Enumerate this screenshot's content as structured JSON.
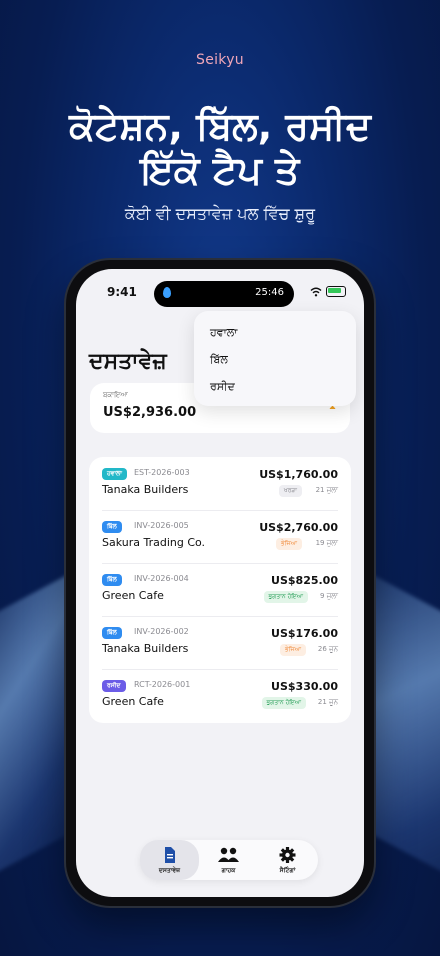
{
  "brand": "Seikyu",
  "headline": {
    "line1": "ਕੋਟੇਸ਼ਨ, ਬਿੱਲ, ਰਸੀਦ",
    "line2": "ਇੱਕੋ ਟੈਪ ਤੇ"
  },
  "subline": "ਕੋਈ ਵੀ ਦਸਤਾਵੇਜ਼ ਪਲ ਵਿੱਚ ਸ਼ੁਰੂ",
  "status_bar": {
    "time": "9:41",
    "island_time": "25:46"
  },
  "page_title": "ਦਸਤਾਵੇਜ਼",
  "menu": {
    "items": [
      "ਹਵਾਲਾ",
      "ਬਿੱਲ",
      "ਰਸੀਦ"
    ]
  },
  "summary": {
    "label": "ਬਕਾਇਆ",
    "value": "US$2,936.00"
  },
  "documents": [
    {
      "type": "ਹਵਾਲਾ",
      "type_color": "#22b8c8",
      "id": "EST-2026-003",
      "client": "Tanaka Builders",
      "amount": "US$1,760.00",
      "status": "ਖਰੜਾ",
      "status_color": "#8a8a90",
      "status_bg": "#eeeef2",
      "date": "21 ਜੁਲਾ"
    },
    {
      "type": "ਬਿੱਲ",
      "type_color": "#2f8cf0",
      "id": "INV-2026-005",
      "client": "Sakura Trading Co.",
      "amount": "US$2,760.00",
      "status": "ਭੇਜਿਆ",
      "status_color": "#f08a3a",
      "status_bg": "#fdeee2",
      "date": "19 ਜੁਲਾ"
    },
    {
      "type": "ਬਿੱਲ",
      "type_color": "#2f8cf0",
      "id": "INV-2026-004",
      "client": "Green Cafe",
      "amount": "US$825.00",
      "status": "ਭੁਗਤਾਨ ਹੋਇਆ",
      "status_color": "#2aa05a",
      "status_bg": "#e2f5e8",
      "date": "9 ਜੁਲਾ"
    },
    {
      "type": "ਬਿੱਲ",
      "type_color": "#2f8cf0",
      "id": "INV-2026-002",
      "client": "Tanaka Builders",
      "amount": "US$176.00",
      "status": "ਭੇਜਿਆ",
      "status_color": "#f08a3a",
      "status_bg": "#fdeee2",
      "date": "26 ਜੂਨ"
    },
    {
      "type": "ਰਸੀਦ",
      "type_color": "#6b5ce7",
      "id": "RCT-2026-001",
      "client": "Green Cafe",
      "amount": "US$330.00",
      "status": "ਭੁਗਤਾਨ ਹੋਇਆ",
      "status_color": "#2aa05a",
      "status_bg": "#e2f5e8",
      "date": "21 ਜੂਨ"
    }
  ],
  "tabs": [
    {
      "label": "ਦਸਤਾਵੇਜ਼",
      "icon": "document-icon",
      "active": true
    },
    {
      "label": "ਗਾਹਕ",
      "icon": "people-icon",
      "active": false
    },
    {
      "label": "ਸੈਟਿੰਗਾਂ",
      "icon": "gear-icon",
      "active": false
    }
  ]
}
